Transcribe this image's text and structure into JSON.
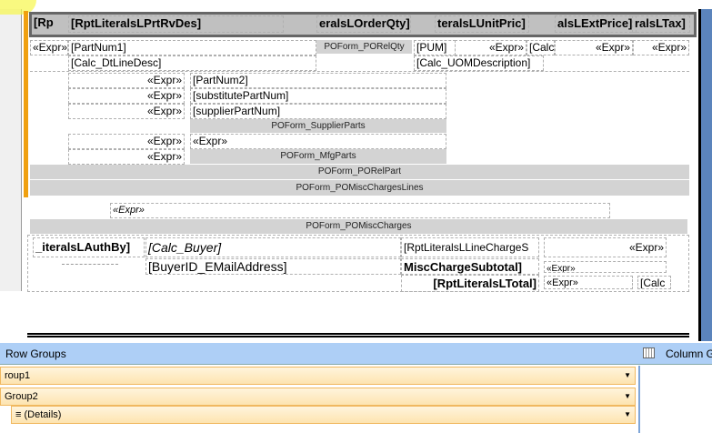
{
  "header": [
    "[Rp",
    "[RptLiteralsLPrtRvDes]",
    "eralsLOrderQty]",
    "teralsLUnitPric]",
    "alsLExtPrice]",
    "ralsLTax]"
  ],
  "row1": {
    "expr": "«Expr»",
    "part": "[PartNum1]",
    "relqty": "POForm_PORelQty",
    "pum": "[PUM]",
    "expr2": "«Expr»",
    "calc": "[Calc",
    "expr3": "«Expr»",
    "expr4": "«Expr»"
  },
  "row2": {
    "desc": "[Calc_DtLineDesc]",
    "uom": "[Calc_UOMDescription]"
  },
  "parts": [
    {
      "expr": "«Expr»",
      "val": "[PartNum2]"
    },
    {
      "expr": "«Expr»",
      "val": "[substitutePartNum]"
    },
    {
      "expr": "«Expr»",
      "val": "[supplierPartNum]"
    }
  ],
  "supplier_parts": "POForm_SupplierParts",
  "mfg_row": {
    "expr": "«Expr»",
    "val": "«Expr»"
  },
  "mfg_row2": {
    "expr": "«Expr»",
    "val": "POForm_MfgParts"
  },
  "rel_part": "POForm_PORelPart",
  "misc_lines": "POForm_POMiscChargesLines",
  "misc_expr": "«Expr»",
  "misc_charges": "POForm_POMiscCharges",
  "footer": {
    "authby": "_iteralsLAuthBy]",
    "buyer": "[Calc_Buyer]",
    "linecharge": "[RptLiteralsLLineChargeS",
    "expr1": "«Expr»",
    "email": "[BuyerID_EMailAddress]",
    "subtotal": "MiscChargeSubtotal]",
    "expr2": "«Expr»",
    "total": "[RptLiteralsLTotal]",
    "expr3": "«Expr»",
    "calc": "[Calc"
  },
  "groups": {
    "row_title": "Row Groups",
    "col_title": "Column G",
    "items": [
      "roup1",
      "Group2",
      "≡ (Details)"
    ]
  }
}
